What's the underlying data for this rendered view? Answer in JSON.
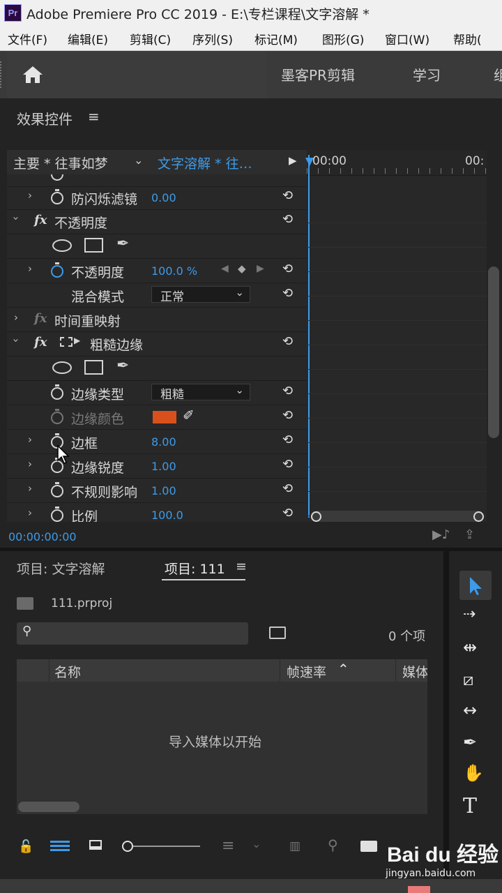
{
  "window": {
    "logo": "Pr",
    "title": "Adobe Premiere Pro CC 2019 - E:\\专栏课程\\文字溶解 *"
  },
  "menu": [
    "文件(F)",
    "编辑(E)",
    "剪辑(C)",
    "序列(S)",
    "标记(M)",
    "图形(G)",
    "窗口(W)",
    "帮助("
  ],
  "workspace": {
    "items": [
      "墨客PR剪辑",
      "学习",
      "组"
    ]
  },
  "effect_controls": {
    "title": "效果控件",
    "master_clip": "主要 * 往事如梦",
    "sequence_clip": "文字溶解 * 往…",
    "timecode_left": "00:00",
    "timecode_right": "00:",
    "current_time": "00:00:00:00",
    "rows": {
      "anti_flicker": {
        "label": "防闪烁滤镜",
        "value": "0.00"
      },
      "opacity_group": {
        "label": "不透明度"
      },
      "opacity": {
        "label": "不透明度",
        "value": "100.0 %"
      },
      "blend_mode": {
        "label": "混合模式",
        "value": "正常"
      },
      "time_remap": {
        "label": "时间重映射"
      },
      "rough_edges": {
        "label": "粗糙边缘"
      },
      "edge_type": {
        "label": "边缘类型",
        "value": "粗糙"
      },
      "edge_color": {
        "label": "边缘颜色",
        "color": "#d9501c"
      },
      "border": {
        "label": "边框",
        "value": "8.00"
      },
      "edge_sharpness": {
        "label": "边缘锐度",
        "value": "1.00"
      },
      "irregular_influence": {
        "label": "不规则影响",
        "value": "1.00"
      },
      "scale": {
        "label": "比例",
        "value": "100.0"
      }
    }
  },
  "project": {
    "tab_inactive": "项目: 文字溶解",
    "tab_active": "项目: 111",
    "file": "111.prproj",
    "item_count": "0 个项",
    "columns": [
      "名称",
      "帧速率",
      "媒体"
    ],
    "empty_message": "导入媒体以开始"
  },
  "watermark": {
    "brand": "Bai du 经验",
    "url": "jingyan.baidu.com"
  },
  "colors": {
    "accent": "#3d9be9",
    "panel": "#232323"
  }
}
